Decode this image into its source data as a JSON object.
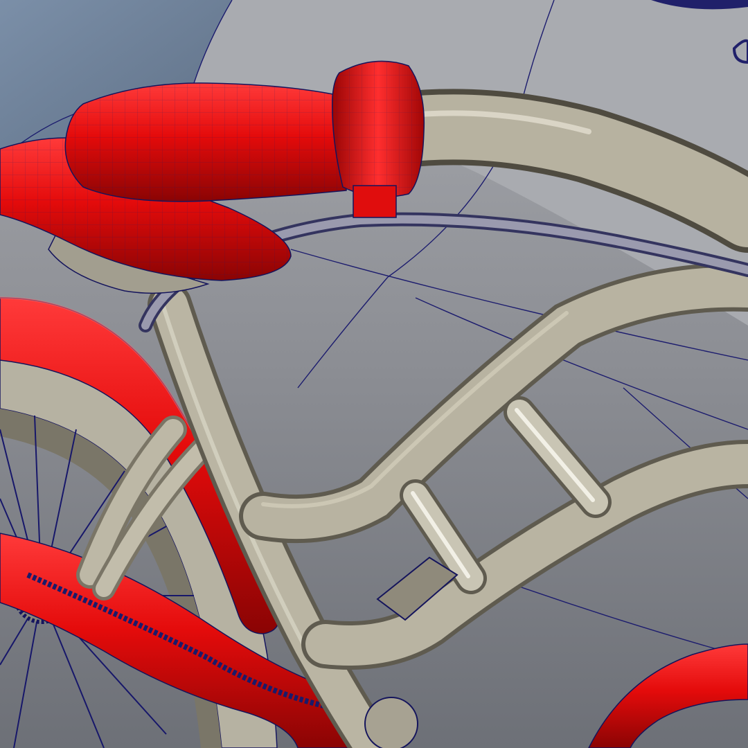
{
  "scene": {
    "subject": "bicycle-frame-wireframe-render",
    "colors": {
      "background_dark": "#6f737a",
      "background_light": "#9a9ca2",
      "backdrop_blue": "#6f86a2",
      "frame_tube": "#b9b4a3",
      "frame_tube_shadow": "#75705f",
      "red_parts": "#e00d0d",
      "red_shadow": "#8f0505",
      "wire": "#14145c"
    }
  }
}
